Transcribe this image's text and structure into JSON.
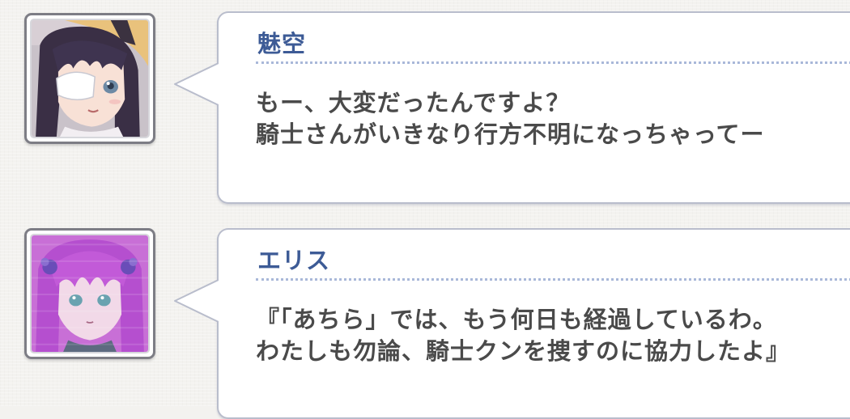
{
  "dialogue": [
    {
      "speaker": "魅空",
      "lines": [
        "もー、大変だったんですよ？",
        "騎士さんがいきなり行方不明になっちゃってー"
      ],
      "portrait": "misora-portrait"
    },
    {
      "speaker": "エリス",
      "lines": [
        "『「あちら」では、もう何日も経過しているわ。",
        "わたしも勿論、騎士クンを捜すのに協力したよ』"
      ],
      "portrait": "eris-portrait"
    }
  ],
  "colors": {
    "background": "#f3f2ef",
    "speaker_name": "#3d5b96",
    "message_text": "#4a4a4a",
    "bubble_border": "#b9bdcc",
    "divider": "#a9b8d9"
  }
}
